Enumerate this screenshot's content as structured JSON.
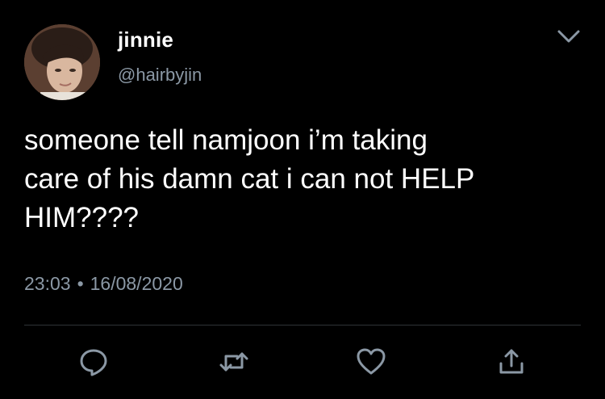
{
  "user": {
    "display_name": "jinnie",
    "handle": "@hairbyjin",
    "avatar_icon": "profile-photo"
  },
  "tweet": {
    "text": "someone tell namjoon i’m taking\ncare of his damn cat i can not HELP\nHIM????",
    "time": "23:03",
    "separator": "•",
    "date": "16/08/2020"
  },
  "menu": {
    "icon": "chevron-down-icon"
  },
  "actions": [
    {
      "name": "reply",
      "icon": "reply-icon"
    },
    {
      "name": "retweet",
      "icon": "retweet-icon"
    },
    {
      "name": "like",
      "icon": "heart-icon"
    },
    {
      "name": "share",
      "icon": "share-icon"
    }
  ],
  "colors": {
    "background": "#000000",
    "text_primary": "#ffffff",
    "text_secondary": "#8b98a5",
    "divider": "#2f3336"
  }
}
